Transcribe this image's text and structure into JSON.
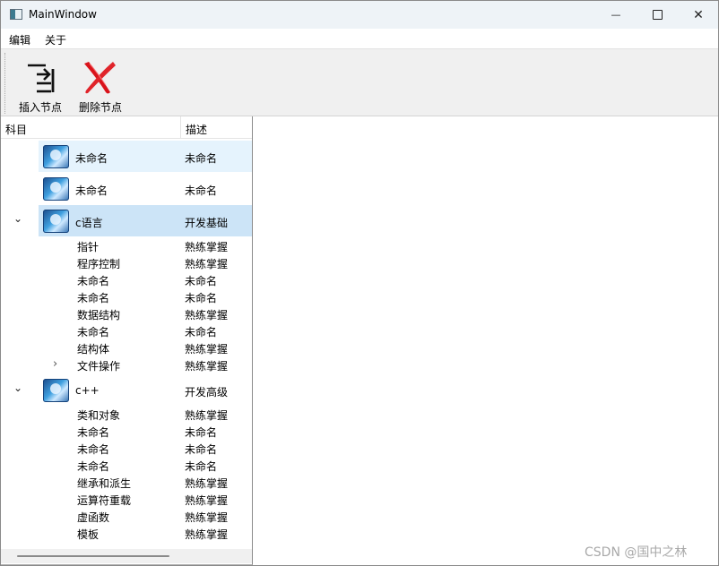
{
  "window": {
    "title": "MainWindow",
    "controls": {
      "minimize": "—",
      "close": "✕"
    }
  },
  "menubar": {
    "items": [
      {
        "label": "编辑"
      },
      {
        "label": "关于"
      }
    ]
  },
  "toolbar": {
    "insert_label": "插入节点",
    "delete_label": "删除节点",
    "colors": {
      "delete_icon": "#d9131b",
      "insert_icon": "#111111"
    }
  },
  "tree": {
    "headers": {
      "subject": "科目",
      "description": "描述"
    },
    "selection_color": "#cce4f7",
    "hover_color": "#e5f3fd",
    "rows": [
      {
        "text": "未命名",
        "desc": "未命名"
      },
      {
        "text": "未命名",
        "desc": "未命名"
      },
      {
        "text": "c语言",
        "desc": "开发基础",
        "expanded": true
      },
      {
        "text": "指针",
        "desc": "熟练掌握"
      },
      {
        "text": "程序控制",
        "desc": "熟练掌握"
      },
      {
        "text": "未命名",
        "desc": "未命名"
      },
      {
        "text": "未命名",
        "desc": "未命名"
      },
      {
        "text": "数据结构",
        "desc": "熟练掌握"
      },
      {
        "text": "未命名",
        "desc": "未命名"
      },
      {
        "text": "结构体",
        "desc": "熟练掌握"
      },
      {
        "text": "文件操作",
        "desc": "熟练掌握",
        "collapsed": true
      },
      {
        "text": "c++",
        "desc": "开发高级",
        "expanded": true
      },
      {
        "text": "类和对象",
        "desc": "熟练掌握"
      },
      {
        "text": "未命名",
        "desc": "未命名"
      },
      {
        "text": "未命名",
        "desc": "未命名"
      },
      {
        "text": "未命名",
        "desc": "未命名"
      },
      {
        "text": "继承和派生",
        "desc": "熟练掌握"
      },
      {
        "text": "运算符重载",
        "desc": "熟练掌握"
      },
      {
        "text": "虚函数",
        "desc": "熟练掌握"
      },
      {
        "text": "模板",
        "desc": "熟练掌握"
      }
    ],
    "glyphs": {
      "expanded": "⌄",
      "collapsed": "›"
    }
  },
  "watermark": "CSDN @国中之林"
}
